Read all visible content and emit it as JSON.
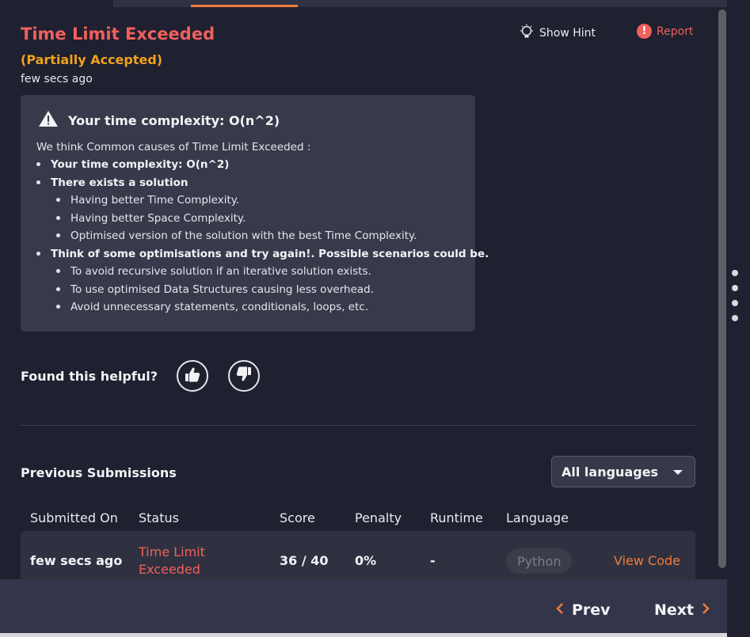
{
  "header": {
    "title": "Time Limit Exceeded",
    "subtitle": "(Partially Accepted)",
    "time_ago": "few secs ago",
    "hint_label": "Show Hint",
    "report_label": "Report",
    "report_icon_glyph": "!"
  },
  "analysis": {
    "heading": "Your time complexity: O(n^2)",
    "intro": "We think Common causes of Time Limit Exceeded :",
    "items": [
      {
        "text": "Your time complexity: O(n^2)",
        "children": []
      },
      {
        "text": "There exists a solution",
        "children": [
          "Having better Time Complexity.",
          "Having better Space Complexity.",
          "Optimised version of the solution with the best Time Complexity."
        ]
      },
      {
        "text": "Think of some optimisations and try again!. Possible scenarios could be.",
        "children": [
          "To avoid recursive solution if an iterative solution exists.",
          "To use optimised Data Structures causing less overhead.",
          "Avoid unnecessary statements, conditionals, loops, etc."
        ]
      }
    ]
  },
  "feedback": {
    "label": "Found this helpful?"
  },
  "submissions": {
    "title": "Previous Submissions",
    "language_filter": "All languages",
    "columns": [
      "Submitted On",
      "Status",
      "Score",
      "Penalty",
      "Runtime",
      "Language"
    ],
    "rows": [
      {
        "submitted_on": "few secs ago",
        "status": "Time Limit Exceeded",
        "score": "36 / 40",
        "penalty": "0%",
        "runtime": "-",
        "language": "Python",
        "action": "View Code"
      }
    ]
  },
  "navigation": {
    "prev": "Prev",
    "next": "Next"
  },
  "colors": {
    "background": "#1f2030",
    "card": "#383a4b",
    "error": "#f0605c",
    "warning": "#f0a21c",
    "accent": "#f07c3a"
  },
  "icons": {
    "hint": "lightbulb-icon",
    "report": "alert-circle-icon",
    "warning": "warning-triangle-icon",
    "thumbs_up": "thumbs-up-icon",
    "thumbs_down": "thumbs-down-icon",
    "dropdown": "caret-down-icon",
    "prev": "chevron-left-icon",
    "next": "chevron-right-icon"
  }
}
